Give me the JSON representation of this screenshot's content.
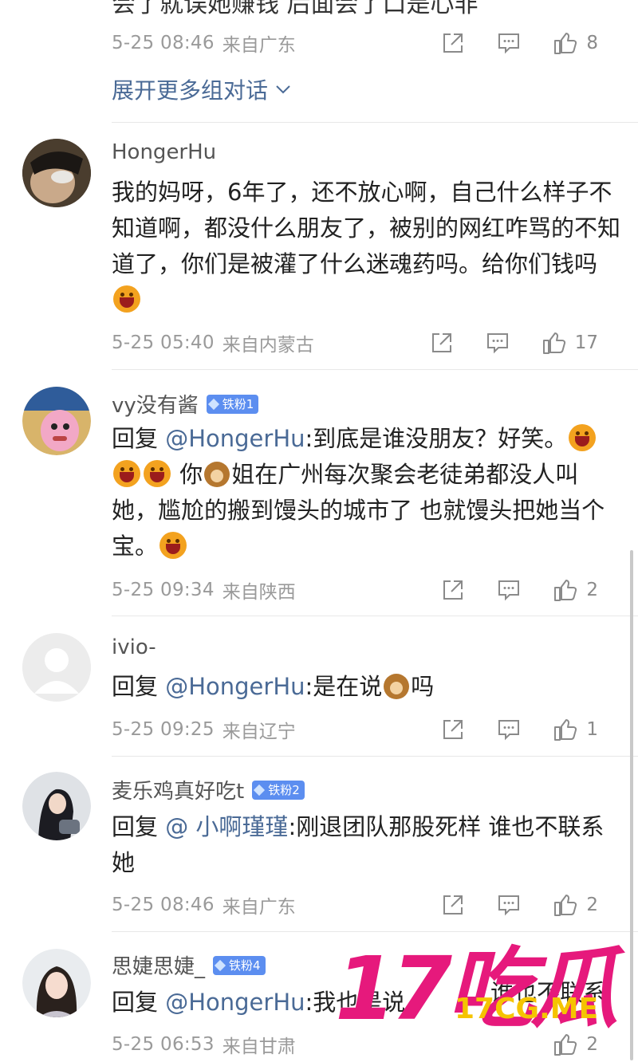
{
  "top_comment": {
    "partial_text": "会了就误她赚钱 后面会了口是心非",
    "date": "5-25 08:46",
    "location": "来自广东",
    "likes": "8"
  },
  "expand_label": "展开更多组对话",
  "comments": [
    {
      "username": "HongerHu",
      "text": "我的妈呀，6年了，还不放心啊，自己什么样子不知道啊，都没什么朋友了，被别的网红咋骂的不知道了，你们是被灌了什么迷魂药吗。给你们钱吗",
      "date": "5-25 05:40",
      "location": "来自内蒙古",
      "likes": "17"
    },
    {
      "username": "vy没有酱",
      "badge": "铁粉1",
      "reply_prefix": "回复 ",
      "mention": "@HongerHu",
      "text_a": ":到底是谁没朋友？好笑。",
      "text_b": " 你",
      "text_c": "姐在广州每次聚会老徒弟都没人叫她，尴尬的搬到馒头的城市了 也就馒头把她当个宝。",
      "date": "5-25 09:34",
      "location": "来自陕西",
      "likes": "2"
    },
    {
      "username": "ivio-",
      "reply_prefix": "回复 ",
      "mention": "@HongerHu",
      "text_a": ":是在说",
      "text_b": "吗",
      "date": "5-25 09:25",
      "location": "来自辽宁",
      "likes": "1"
    },
    {
      "username": "麦乐鸡真好吃t",
      "badge": "铁粉2",
      "reply_prefix": "回复 ",
      "mention": "@ 小啊瑾瑾",
      "text_a": ":刚退团队那股死样 谁也不联系她",
      "date": "5-25 08:46",
      "location": "来自广东",
      "likes": "2"
    },
    {
      "username": "思婕思婕_",
      "badge": "铁粉4",
      "reply_prefix": "回复 ",
      "mention": "@HongerHu",
      "text_a": ":我也是说",
      "date": "5-25 06:53",
      "location": "来自甘肃",
      "likes": "2"
    }
  ],
  "overlay_text": "谁也不联系",
  "watermark": {
    "main": "17吃瓜",
    "sub": "17CG.ME"
  },
  "colors": {
    "link": "#4a6a96",
    "meta": "#9a9a9a",
    "badge": "#5c8ef0",
    "watermark_main": "#e6197c",
    "watermark_sub": "#f5c400"
  }
}
